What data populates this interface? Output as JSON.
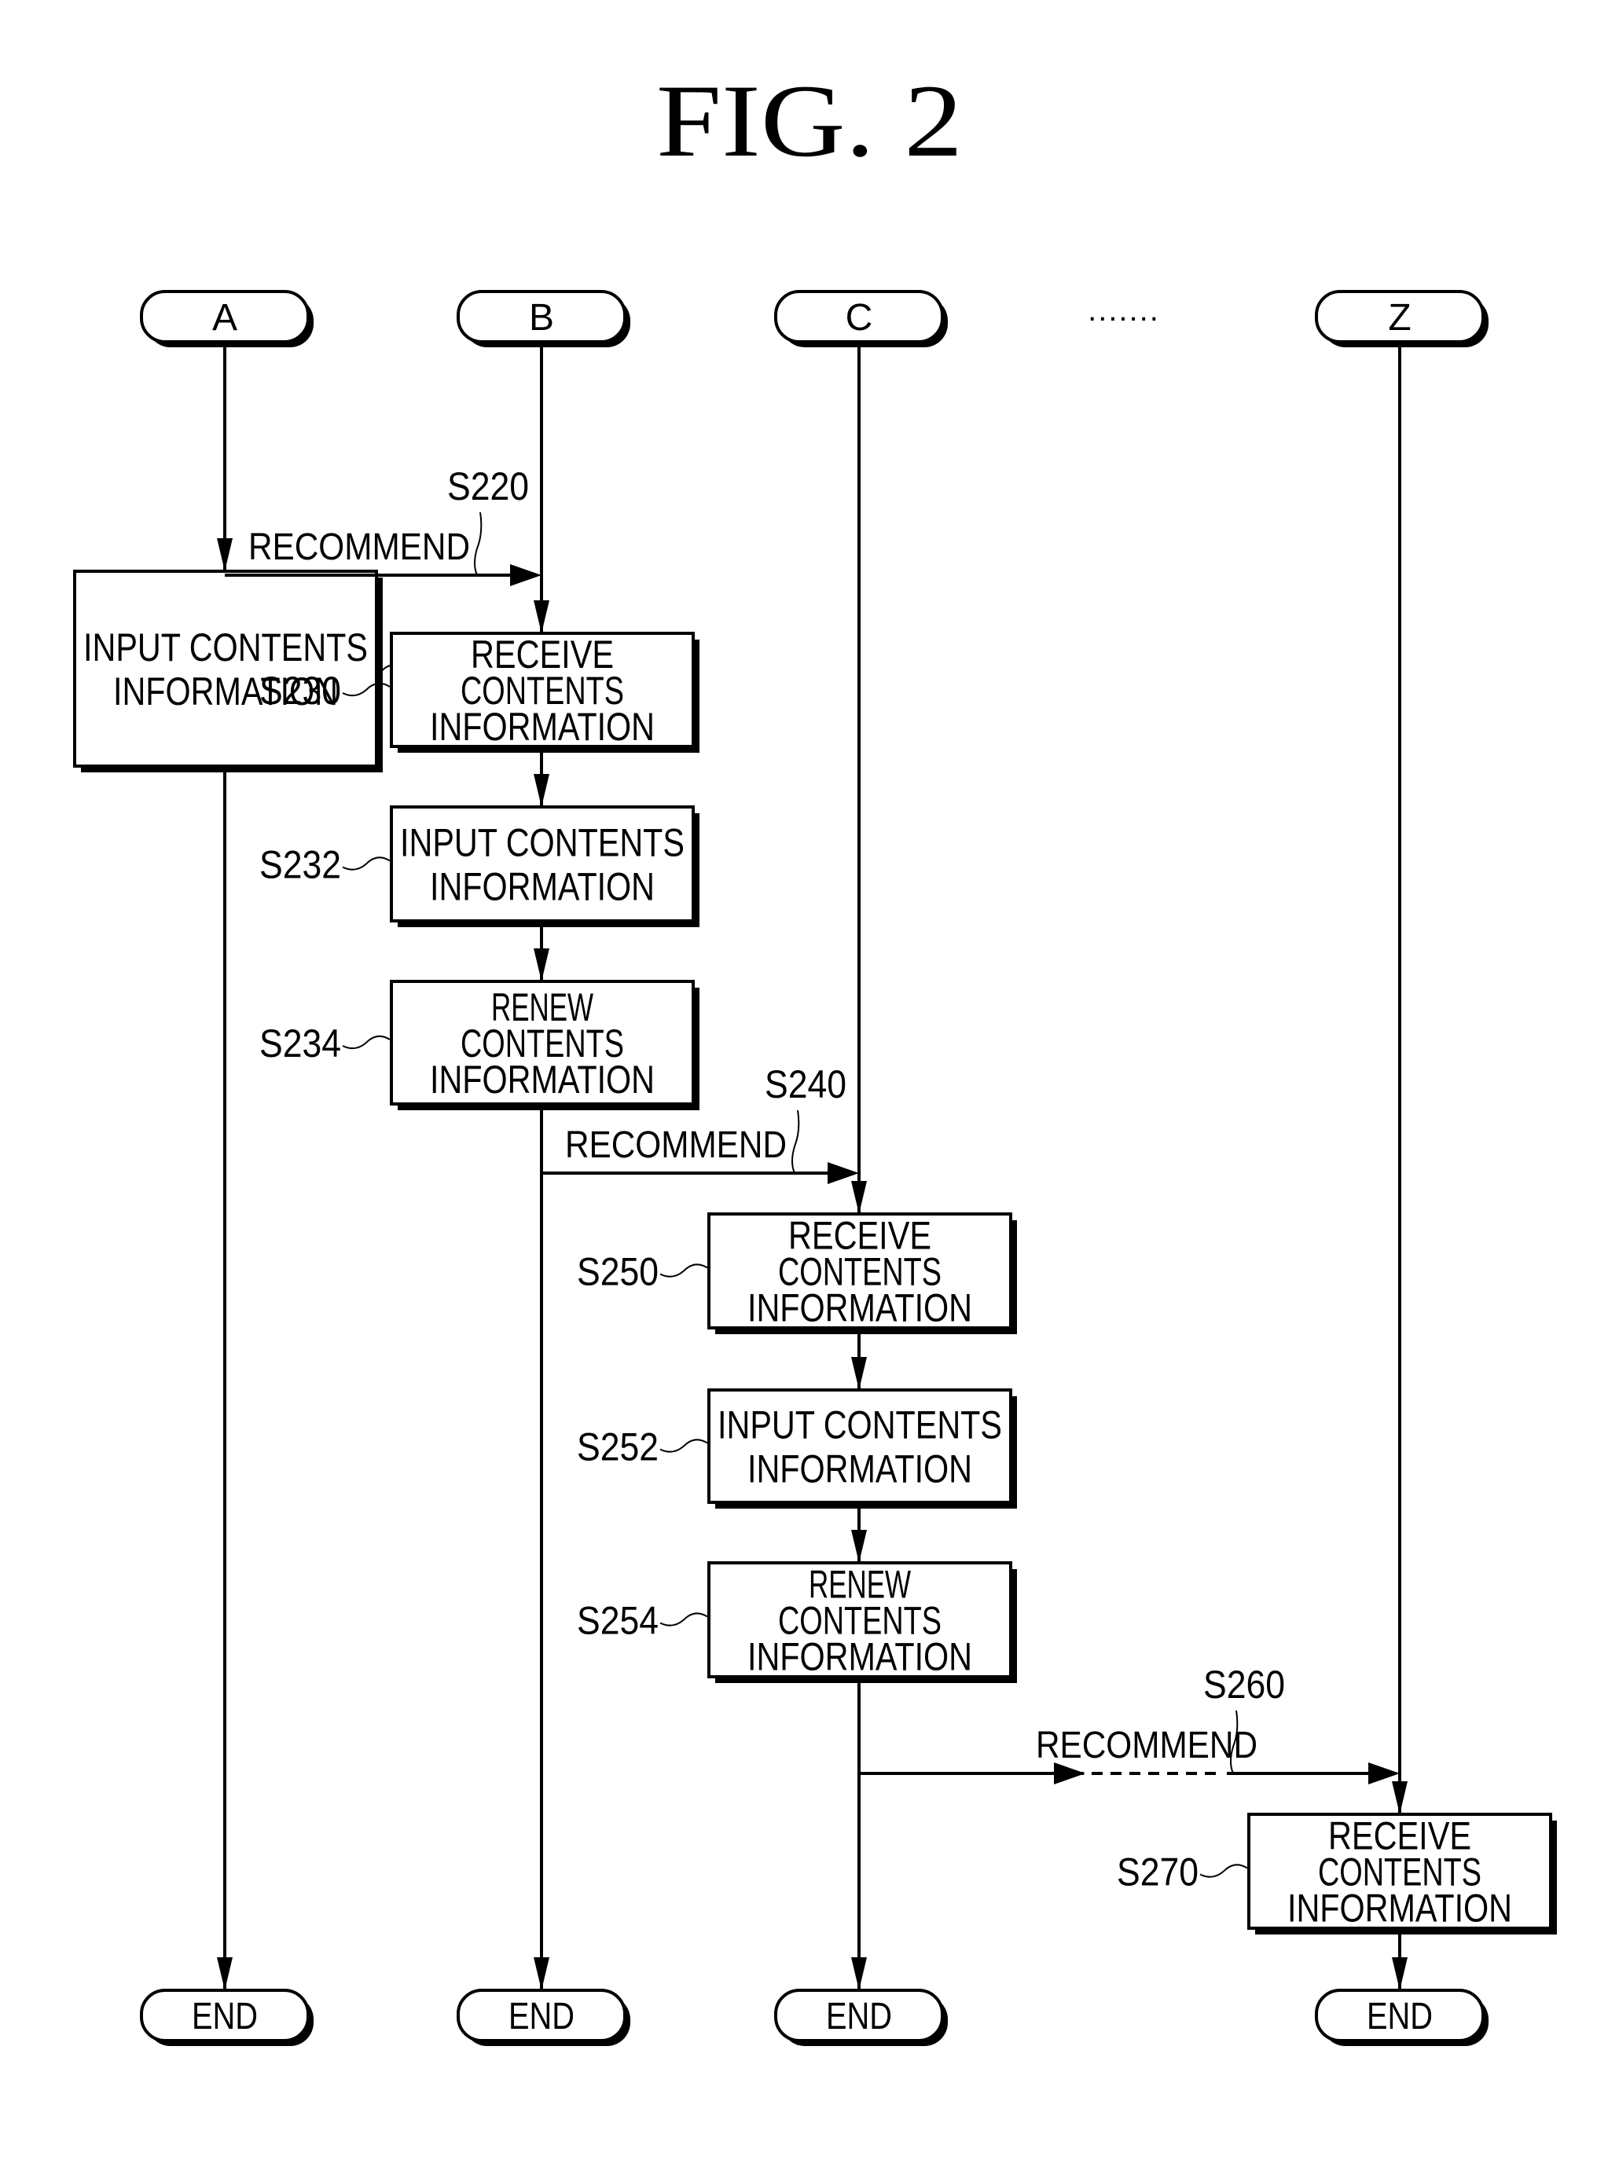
{
  "figure": {
    "title": "FIG. 2",
    "ellipsis": "......."
  },
  "lanes": [
    {
      "id": "A",
      "label": "A",
      "end_label": "END"
    },
    {
      "id": "B",
      "label": "B",
      "end_label": "END"
    },
    {
      "id": "C",
      "label": "C",
      "end_label": "END"
    },
    {
      "id": "Z",
      "label": "Z",
      "end_label": "END"
    }
  ],
  "steps": [
    {
      "id": "S210",
      "lane": "A",
      "lines": [
        "INPUT CONTENTS",
        "INFORMATION"
      ],
      "label_side": "right"
    },
    {
      "id": "S230",
      "lane": "B",
      "lines": [
        "RECEIVE",
        "CONTENTS",
        "INFORMATION"
      ],
      "label_side": "left"
    },
    {
      "id": "S232",
      "lane": "B",
      "lines": [
        "INPUT CONTENTS",
        "INFORMATION"
      ],
      "label_side": "left"
    },
    {
      "id": "S234",
      "lane": "B",
      "lines": [
        "RENEW",
        "CONTENTS",
        "INFORMATION"
      ],
      "label_side": "left"
    },
    {
      "id": "S250",
      "lane": "C",
      "lines": [
        "RECEIVE",
        "CONTENTS",
        "INFORMATION"
      ],
      "label_side": "left"
    },
    {
      "id": "S252",
      "lane": "C",
      "lines": [
        "INPUT CONTENTS",
        "INFORMATION"
      ],
      "label_side": "left"
    },
    {
      "id": "S254",
      "lane": "C",
      "lines": [
        "RENEW",
        "CONTENTS",
        "INFORMATION"
      ],
      "label_side": "left"
    },
    {
      "id": "S270",
      "lane": "Z",
      "lines": [
        "RECEIVE",
        "CONTENTS",
        "INFORMATION"
      ],
      "label_side": "left"
    }
  ],
  "messages": [
    {
      "id": "S220",
      "from": "A",
      "to": "B",
      "label": "RECOMMEND",
      "dashed_gap": false
    },
    {
      "id": "S240",
      "from": "B",
      "to": "C",
      "label": "RECOMMEND",
      "dashed_gap": false
    },
    {
      "id": "S260",
      "from": "C",
      "to": "Z",
      "label": "RECOMMEND",
      "dashed_gap": true
    }
  ]
}
